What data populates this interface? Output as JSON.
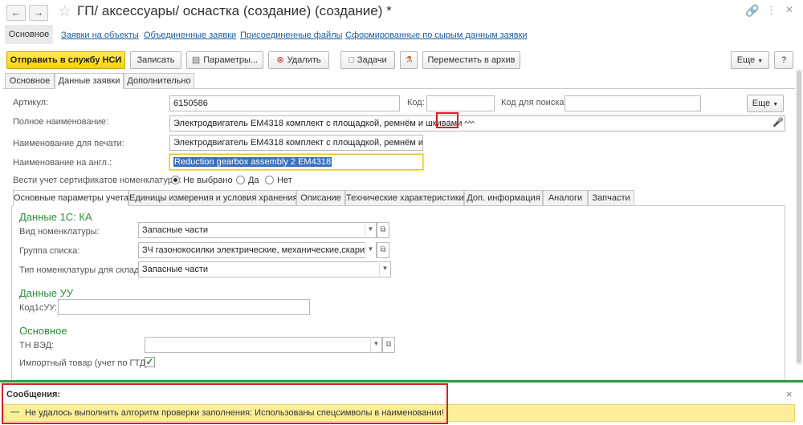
{
  "window": {
    "title": "ГП/ аксессуары/ оснастка (создание) (создание) *",
    "back_icon": "arrow-left-icon",
    "forward_icon": "arrow-right-icon"
  },
  "nav_links": [
    "Основное",
    "Заявки на объекты",
    "Объединенные заявки",
    "Присоединенные файлы",
    "Сформированные по сырым данным заявки"
  ],
  "toolbar": {
    "send_label": "Отправить в службу НСИ",
    "save_label": "Записать",
    "params_label": "Параметры...",
    "delete_label": "Удалить",
    "tasks_label": "Задачи",
    "archive_label": "Переместить в архив",
    "more_label": "Еще",
    "help_label": "?"
  },
  "tabs": [
    "Основное",
    "Данные заявки",
    "Дополнительно"
  ],
  "form": {
    "article_label": "Артикул:",
    "article_value": "6150586",
    "code_label": "Код:",
    "code_value": "",
    "search_code_label": "Код для поиска:",
    "search_code_value": "",
    "more_label": "Еще",
    "full_name_label": "Полное наименование:",
    "full_name_value": "Электродвигатель EM4318 комплект с площадкой, ремнём и шкивами",
    "full_name_suffix": "^^^",
    "print_name_label": "Наименование для печати:",
    "print_name_value": "Электродвигатель EM4318 комплект с площадкой, ремнём и шкив",
    "eng_name_label": "Наименование на англ.:",
    "eng_name_value": "Reduction gearbox assembly 2 EM4318",
    "cert_label": "Вести учет сертификатов номенклатуры:",
    "cert_options": [
      "Не выбрано",
      "Да",
      "Нет"
    ]
  },
  "subtabs": [
    "Основные параметры учета",
    "Единицы измерения и условия хранения",
    "Описание",
    "Технические характеристики",
    "Доп. информация",
    "Аналоги",
    "Запчасти"
  ],
  "section_1c": {
    "title": "Данные 1С: КА",
    "kind_label": "Вид номенклатуры:",
    "kind_value": "Запасные части",
    "group_label": "Группа списка:",
    "group_value": "ЗЧ газонокосилки электрические, механические,скарифика",
    "wh_type_label": "Тип номенклатуры для склада:",
    "wh_type_value": "Запасные части"
  },
  "section_uu": {
    "title": "Данные УУ",
    "code_label": "Код1сУУ:",
    "code_value": ""
  },
  "section_main": {
    "title": "Основное",
    "tnved_label": "ТН ВЭД:",
    "tnved_value": "",
    "import_label": "Импортный товар (учет по ГТД):",
    "import_checked": "✓"
  },
  "messages": {
    "title": "Сообщения:",
    "close": "×",
    "dash": "—",
    "text": "Не удалось выполнить алгоритм проверки заполнения: Использованы спецсимволы в наименовании!"
  },
  "colors": {
    "accent_yellow": "#f5d20a",
    "link_blue": "#1a5c9e",
    "section_green": "#2e8b3a",
    "highlight_red": "#d2202a",
    "message_bg": "#fbef9b"
  }
}
